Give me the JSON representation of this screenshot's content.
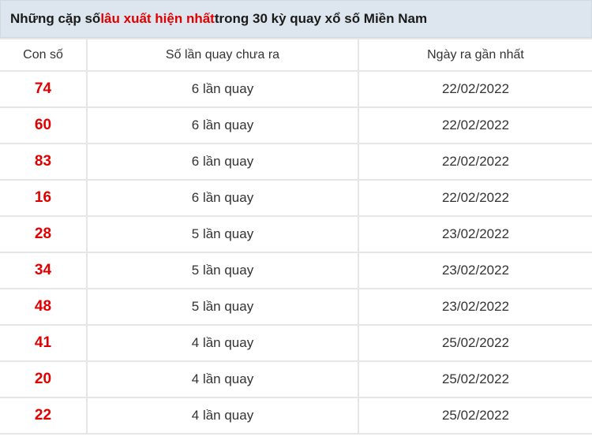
{
  "title": {
    "prefix": "Những cặp số ",
    "highlight": "lâu xuất hiện nhất",
    "suffix": " trong 30 kỳ quay xổ số Miền Nam"
  },
  "table": {
    "headers": [
      "Con số",
      "Số lần quay chưa ra",
      "Ngày ra gần nhất"
    ],
    "rows": [
      {
        "number": "74",
        "count": "6 lần quay",
        "date": "22/02/2022"
      },
      {
        "number": "60",
        "count": "6 lần quay",
        "date": "22/02/2022"
      },
      {
        "number": "83",
        "count": "6 lần quay",
        "date": "22/02/2022"
      },
      {
        "number": "16",
        "count": "6 lần quay",
        "date": "22/02/2022"
      },
      {
        "number": "28",
        "count": "5 lần quay",
        "date": "23/02/2022"
      },
      {
        "number": "34",
        "count": "5 lần quay",
        "date": "23/02/2022"
      },
      {
        "number": "48",
        "count": "5 lần quay",
        "date": "23/02/2022"
      },
      {
        "number": "41",
        "count": "4 lần quay",
        "date": "25/02/2022"
      },
      {
        "number": "20",
        "count": "4 lần quay",
        "date": "25/02/2022"
      },
      {
        "number": "22",
        "count": "4 lần quay",
        "date": "25/02/2022"
      }
    ]
  },
  "colors": {
    "highlight": "#e00000",
    "header_bg": "#dde6ee",
    "grid": "#e6e6e6"
  }
}
